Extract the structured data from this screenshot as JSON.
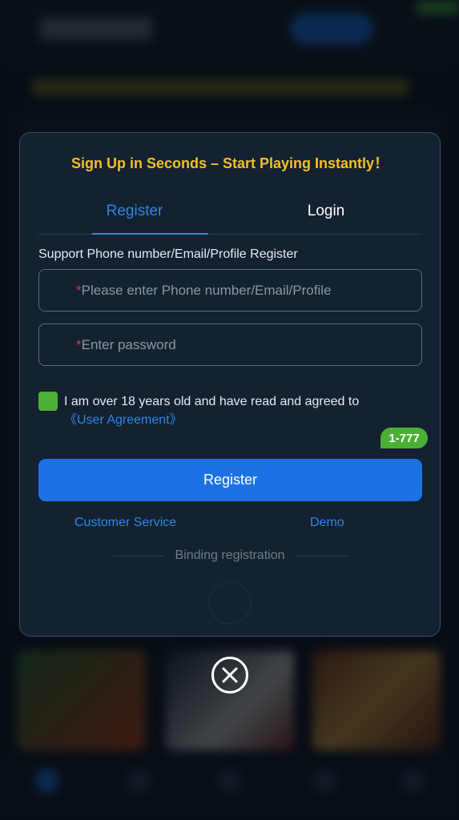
{
  "modal": {
    "title": "Sign Up in Seconds – Start Playing Instantly！",
    "tabs": [
      {
        "label": "Register",
        "active": true
      },
      {
        "label": "Login",
        "active": false
      }
    ],
    "support_label": "Support Phone number/Email/Profile Register",
    "account_field": {
      "required_mark": "*",
      "placeholder": "Please enter Phone number/Email/Profile"
    },
    "password_field": {
      "required_mark": "*",
      "placeholder": "Enter password"
    },
    "agreement": {
      "checked": true,
      "text": "I am over 18 years old and have read and agreed to",
      "link": "《User Agreement》"
    },
    "badge": "1-777",
    "register_button": "Register",
    "customer_service": "Customer Service",
    "demo": "Demo",
    "binding_registration": "Binding registration"
  },
  "close": {
    "icon": "close-icon"
  },
  "colors": {
    "accent_blue": "#1d72e3",
    "title_yellow": "#f5c024",
    "check_green": "#4cb135",
    "required_red": "#d93f3f"
  }
}
